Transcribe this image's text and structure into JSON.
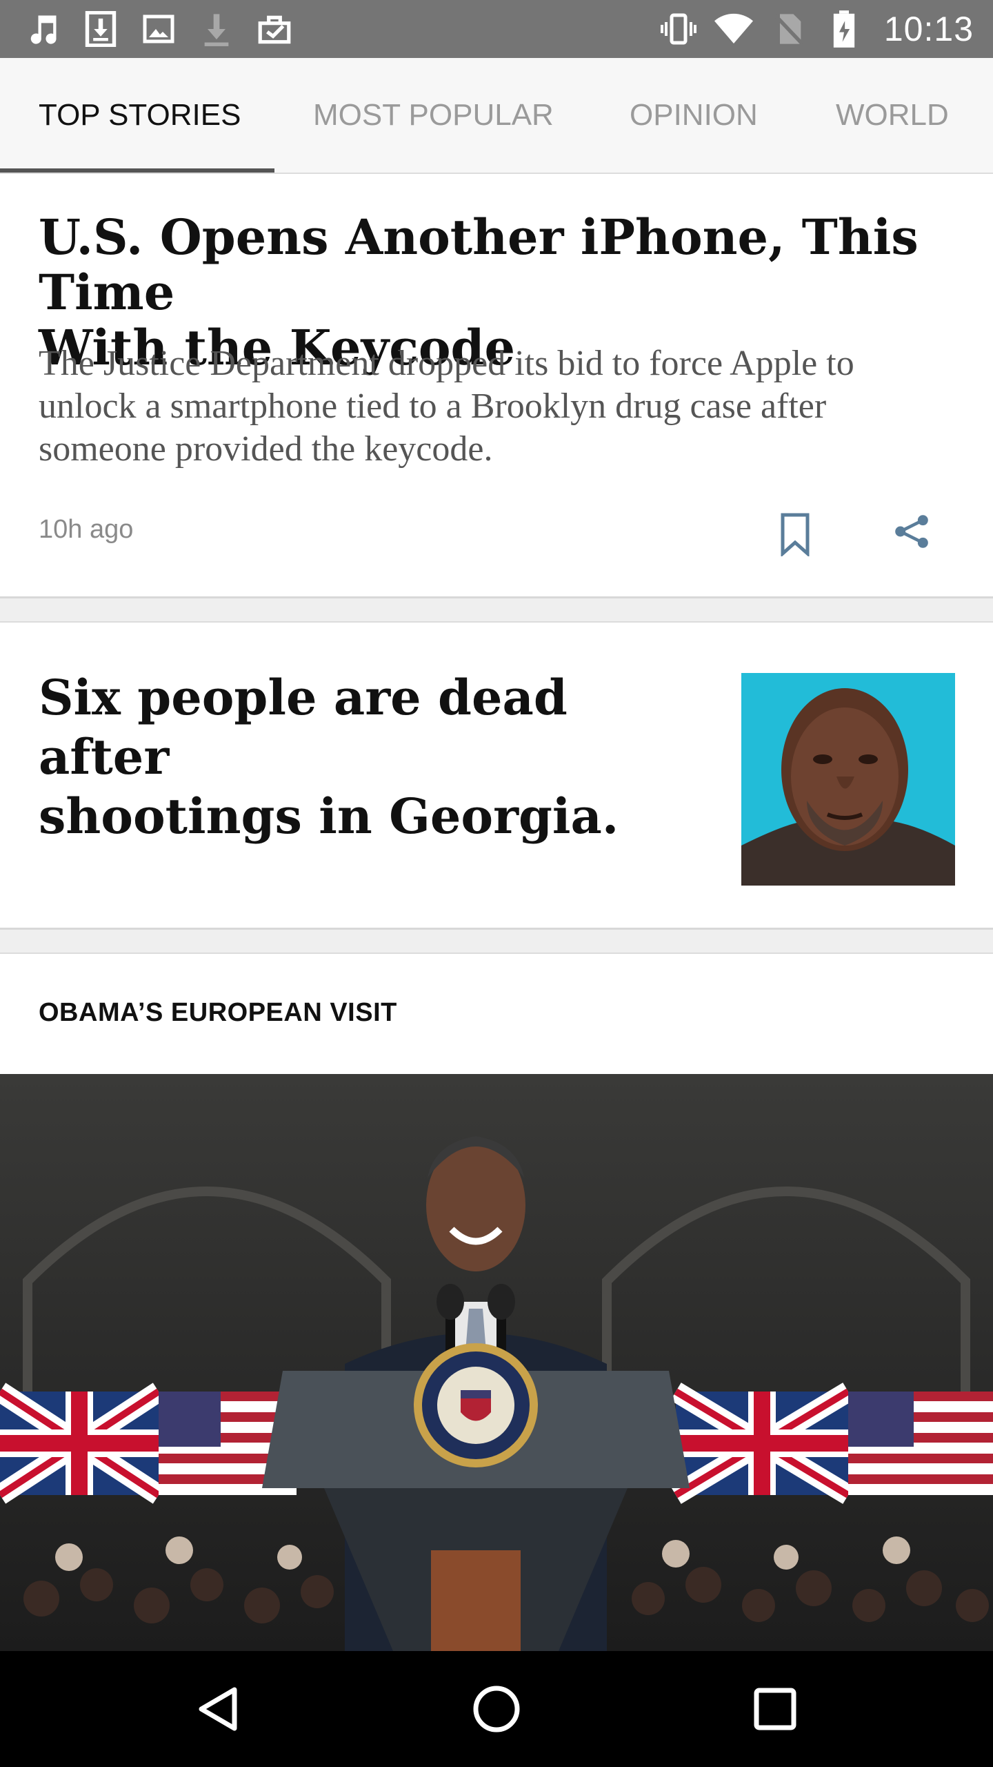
{
  "status_bar": {
    "time": "10:13",
    "left_icons": [
      "music-icon",
      "download-icon",
      "image-icon",
      "download-faded-icon",
      "briefcase-check-icon"
    ],
    "right_icons": [
      "vibrate-icon",
      "wifi-icon",
      "no-sim-icon",
      "battery-icon"
    ]
  },
  "tabs": [
    {
      "label": "TOP STORIES",
      "active": true
    },
    {
      "label": "MOST POPULAR",
      "active": false
    },
    {
      "label": "OPINION",
      "active": false
    },
    {
      "label": "WORLD",
      "active": false
    }
  ],
  "articles": [
    {
      "headline_line1": "U.S. Opens Another iPhone, This Time",
      "headline_line2": "With the Keycode",
      "summary_line1": "The Justice Department dropped its bid to force Apple to",
      "summary_line2": "unlock a smartphone tied to a Brooklyn drug case after",
      "summary_line3": "someone provided the keycode.",
      "timestamp": "10h ago",
      "actions": [
        "bookmark-icon",
        "share-icon"
      ]
    },
    {
      "headline_line1": "Six people are dead after",
      "headline_line2": "shootings in Georgia.",
      "thumbnail": "photo-thumbnail"
    },
    {
      "kicker": "OBAMA’S EUROPEAN VISIT",
      "hero_image": "hero-photo"
    }
  ],
  "colors": {
    "status_bar": "#757575",
    "tab_bar": "#f7f7f7",
    "active_tab_text": "#111111",
    "inactive_tab_text": "#9a9a9a",
    "icon_blue": "#5a7d9a",
    "nav_bar": "#000000"
  },
  "nav_bar": [
    "back-icon",
    "home-icon",
    "recents-icon"
  ]
}
